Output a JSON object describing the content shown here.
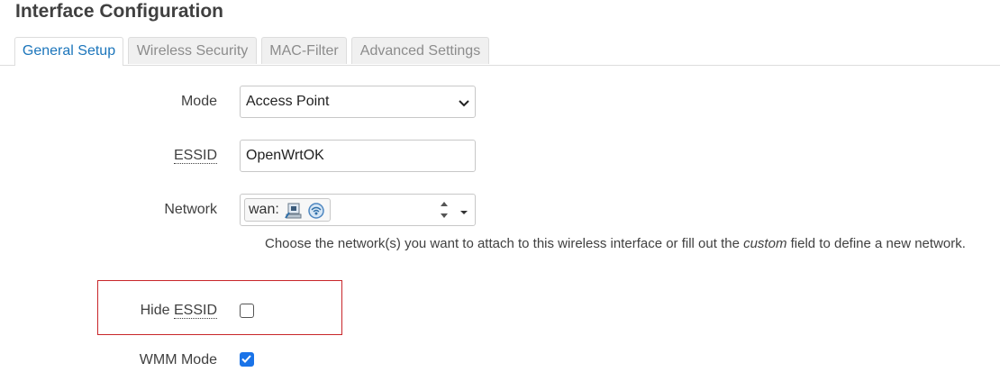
{
  "page": {
    "title": "Interface Configuration"
  },
  "tabs": [
    {
      "label": "General Setup",
      "active": true
    },
    {
      "label": "Wireless Security",
      "active": false
    },
    {
      "label": "MAC-Filter",
      "active": false
    },
    {
      "label": "Advanced Settings",
      "active": false
    }
  ],
  "form": {
    "mode": {
      "label": "Mode",
      "value": "Access Point"
    },
    "essid": {
      "label": "ESSID",
      "value": "OpenWrtOK"
    },
    "network": {
      "label": "Network",
      "chip_text": "wan:",
      "chip_icons": [
        "ethernet-port-icon",
        "wireless-network-icon"
      ],
      "help_before": "Choose the network(s) you want to attach to this wireless interface or fill out the ",
      "help_em": "custom",
      "help_after": " field to define a new network."
    },
    "hide_essid": {
      "label_prefix": "Hide ",
      "label_abbr": "ESSID",
      "checked": false
    },
    "wmm_mode": {
      "label": "WMM Mode",
      "checked": true
    }
  },
  "colors": {
    "tab_active_text": "#1b75bb",
    "checkbox_checked": "#1a73e8",
    "highlight_border": "#c8262a"
  }
}
